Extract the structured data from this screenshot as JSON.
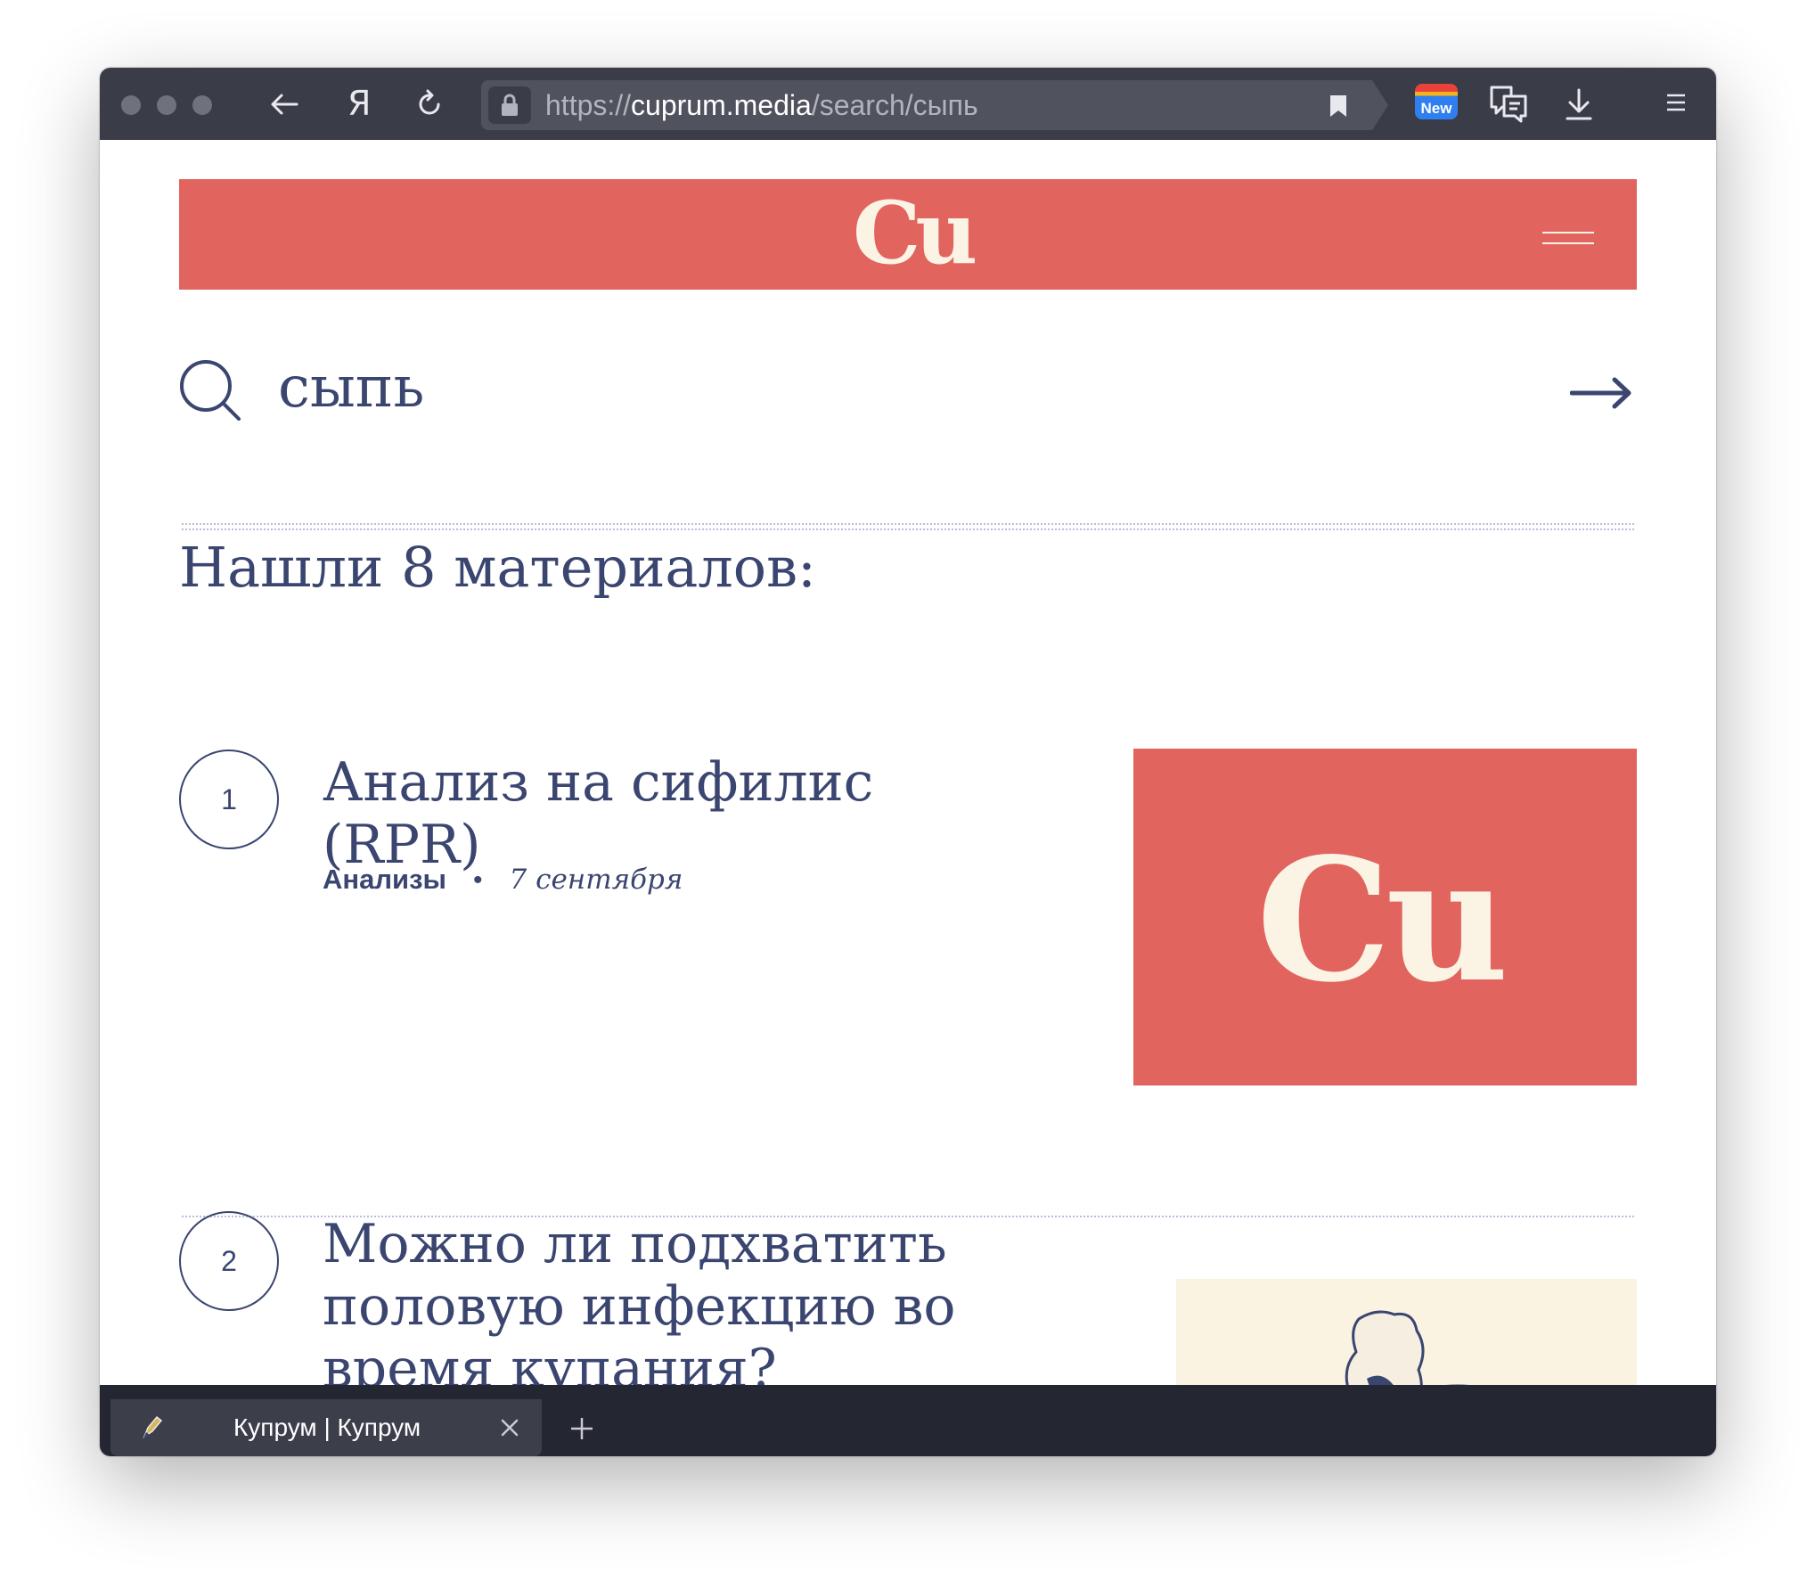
{
  "browser": {
    "url_scheme": "https://",
    "url_host": "cuprum.media",
    "url_path": "/search/сыпь",
    "ya_button": "Я",
    "extension_badge": "New"
  },
  "site": {
    "logo": "Cu",
    "brand_color": "#e1645f",
    "text_color": "#3a4570",
    "logo_color": "#fbf4e4"
  },
  "search": {
    "query": "сыпь"
  },
  "results": {
    "title": "Нашли 8 материалов:",
    "items": [
      {
        "number": "1",
        "title": "Анализ на сифилис (RPR)",
        "category": "Анализы",
        "date": "7 сентября",
        "thumbnail": "Cu"
      },
      {
        "number": "2",
        "title": "Можно ли подхватить половую инфекцию во время купания?",
        "thumbnail": "illustration-swimmers"
      }
    ]
  },
  "tabs": [
    {
      "title": "Купрум | Купрум"
    }
  ]
}
